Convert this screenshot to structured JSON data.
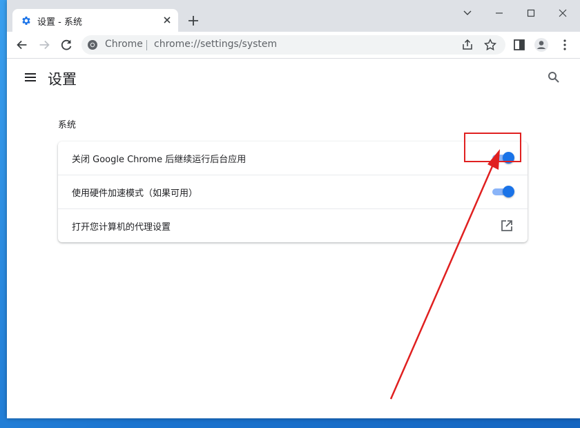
{
  "browser": {
    "tab_title": "设置 - 系统",
    "omnibox_origin": "Chrome",
    "omnibox_url": "chrome://settings/system",
    "accent_color": "#1a73e8"
  },
  "settings": {
    "page_title": "设置",
    "section_title": "系统",
    "rows": [
      {
        "label": "关闭 Google Chrome 后继续运行后台应用",
        "control": "toggle",
        "enabled": true
      },
      {
        "label": "使用硬件加速模式（如果可用）",
        "control": "toggle",
        "enabled": true
      },
      {
        "label": "打开您计算机的代理设置",
        "control": "external-link"
      }
    ]
  },
  "annotation": {
    "color": "#e02020"
  },
  "icons": [
    "settings-gear-icon",
    "close-icon",
    "plus-icon",
    "minimize-icon",
    "maximize-icon",
    "chevron-down-icon",
    "back-icon",
    "forward-icon",
    "reload-icon",
    "chrome-logo-icon",
    "share-icon",
    "star-icon",
    "side-panel-icon",
    "profile-icon",
    "more-icon",
    "menu-icon",
    "search-icon",
    "open-in-new-icon"
  ]
}
